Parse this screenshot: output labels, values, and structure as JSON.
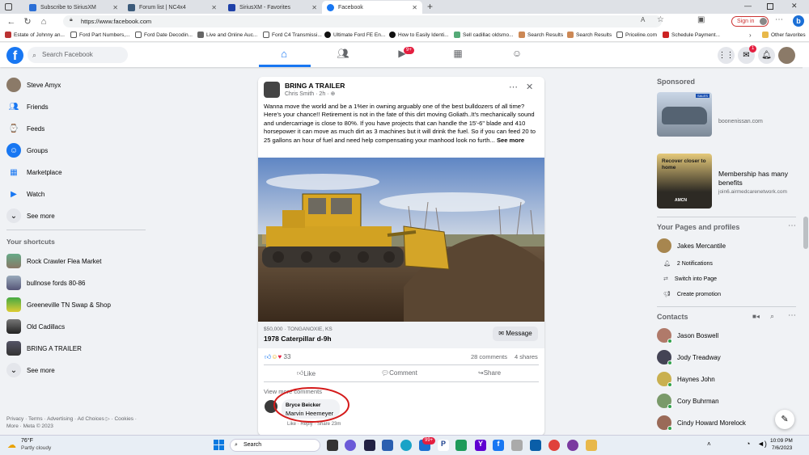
{
  "tabs": [
    {
      "title": "Subscribe to SiriusXM",
      "color": "#2b6fd6"
    },
    {
      "title": "Forum list | NC4x4",
      "color": "#3b5a7a"
    },
    {
      "title": "SiriusXM - Favorites",
      "color": "#1e40a8"
    },
    {
      "title": "Facebook",
      "color": "#1877f2"
    }
  ],
  "address": {
    "url": "https://www.facebook.com"
  },
  "browser_right": {
    "sign_in": "Sign in"
  },
  "favorites": [
    "Estate of Johnny an...",
    "Ford Part Numbers,...",
    "Ford Date Decodin...",
    "Live and Online Auc...",
    "Ford C4 Transmissi...",
    "Ultimate Ford FE En...",
    "How to Easily Identi...",
    "Sell cadillac oldsmo...",
    "Search Results",
    "Search Results",
    "Priceline.com",
    "Schedule Payment...",
    "Other favorites"
  ],
  "fb": {
    "search_placeholder": "Search Facebook",
    "watch_badge": "9+",
    "messenger_badge": "1"
  },
  "left_nav": {
    "items": [
      "Steve Amyx",
      "Friends",
      "Feeds",
      "Groups",
      "Marketplace",
      "Watch",
      "See more"
    ],
    "shortcuts_title": "Your shortcuts",
    "shortcuts": [
      "Rock Crawler Flea Market",
      "bullnose fords 80-86",
      "Greeneville TN Swap & Shop",
      "Old Cadillacs",
      "BRING A TRAILER",
      "See more"
    ],
    "footer": "Privacy · Terms · Advertising · Ad Choices ▷ · Cookies · More · Meta © 2023"
  },
  "post": {
    "group": "BRING A TRAILER",
    "author": "Chris Smith",
    "time": "2h",
    "body": "Wanna move the world and be a 1%er in owning arguably one of the best bulldozers of all time? Here's your chance!! Retirement is not in the fate of this dirt moving Goliath..It's mechanically sound and undercarriage is close to 80%.  If you have projects that can handle the 15'-6\" blade and 410 horsepower it can move as much dirt as 3 machines but it will drink the fuel.  So if you can feed 20 to 25 gallons an hour of fuel and need help compensating your manhood look no furth...",
    "see_more": "See more",
    "listing_price": "$50,000 · TONGANOXIE, KS",
    "listing_title": "1978 Caterpillar d-9h",
    "message_btn": "Message",
    "reactions": "33",
    "comments": "28 comments",
    "shares": "4 shares",
    "like": "Like",
    "comment": "Comment",
    "share": "Share",
    "view_more": "View more comments",
    "comment_author": "Bryce Beicker",
    "comment_text": "Marvin Heemeyer",
    "comment_actions": "Like · Reply · Share",
    "comment_time": "23m"
  },
  "right": {
    "sponsored": "Sponsored",
    "ad1_domain": "boonenissan.com",
    "ad2_title": "Membership has many benefits",
    "ad2_domain": "join6.airmedcarenetwork.com",
    "ad2_img_title": "Recover closer to home",
    "ad2_img_brand": "AMCN",
    "ad1_tag": "SALES",
    "pages_title": "Your Pages and profiles",
    "page_name": "Jakes Mercantile",
    "page_notif": "2 Notifications",
    "page_switch": "Switch into Page",
    "page_promo": "Create promotion",
    "contacts_title": "Contacts",
    "contacts": [
      "Jason Boswell",
      "Jody Treadway",
      "Haynes John",
      "Cory Buhrman",
      "Cindy Howard Morelock"
    ]
  },
  "taskbar": {
    "temp": "76°F",
    "weather": "Partly cloudy",
    "search": "Search",
    "time": "10:09 PM",
    "date": "7/6/2023",
    "notif_badge": "99+"
  }
}
